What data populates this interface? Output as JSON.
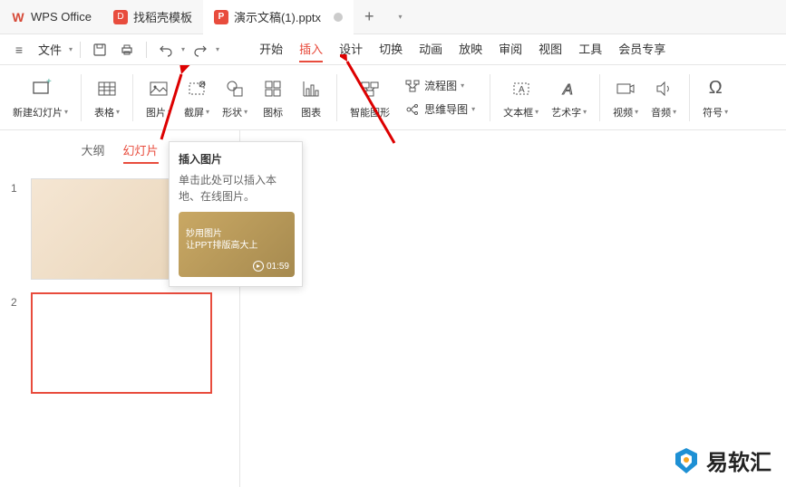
{
  "title_bar": {
    "app_name": "WPS Office",
    "tab_template": "找稻壳模板",
    "tab_doc": "演示文稿(1).pptx"
  },
  "menu_bar": {
    "file": "文件",
    "tabs": [
      "开始",
      "插入",
      "设计",
      "切换",
      "动画",
      "放映",
      "审阅",
      "视图",
      "工具",
      "会员专享"
    ],
    "active_index": 1
  },
  "ribbon": {
    "new_slide": "新建幻灯片",
    "table": "表格",
    "image": "图片",
    "screenshot": "截屏",
    "shape": "形状",
    "icon": "图标",
    "chart": "图表",
    "smartart": "智能图形",
    "flowchart": "流程图",
    "mindmap": "思维导图",
    "textbox": "文本框",
    "wordart": "艺术字",
    "video": "视频",
    "audio": "音频",
    "symbol": "符号"
  },
  "sidebar": {
    "tab_outline": "大纲",
    "tab_slides": "幻灯片",
    "thumbs": [
      1,
      2
    ]
  },
  "tooltip": {
    "title": "插入图片",
    "desc": "单击此处可以插入本地、在线图片。",
    "card_line1": "妙用图片",
    "card_line2": "让PPT排版高大上",
    "duration": "01:59"
  },
  "watermark": "易软汇"
}
